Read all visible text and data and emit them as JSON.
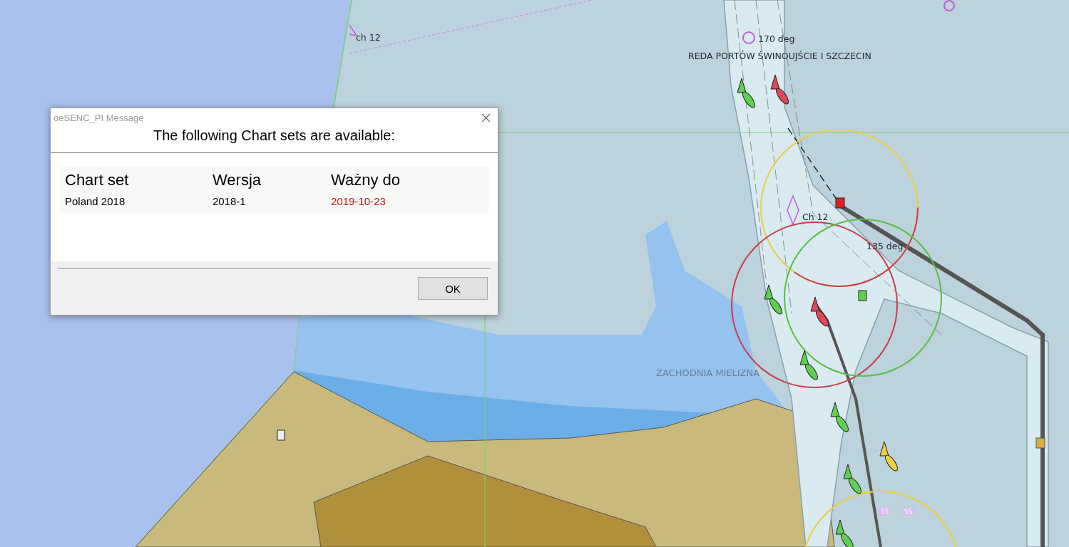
{
  "chart_labels": [
    {
      "text": "ch 12",
      "kind": "name"
    },
    {
      "text": "170 deg",
      "kind": "name"
    },
    {
      "text": "REDA PORTÓW ŚWINOUJŚCIE I SZCZECIN",
      "kind": "name"
    },
    {
      "text": "Ch 12",
      "kind": "name"
    },
    {
      "text": "135 deg",
      "kind": "name"
    },
    {
      "text": "ZACHODNIA MIELIZNA",
      "kind": "area"
    },
    {
      "text": "SS",
      "kind": "tag"
    },
    {
      "text": "SS",
      "kind": "tag"
    }
  ],
  "dialog": {
    "title": "oeSENC_PI Message",
    "heading": "The following Chart sets are available:",
    "columns": [
      "Chart set",
      "Wersja",
      "Ważny do"
    ],
    "rows": [
      {
        "cells": [
          "Poland 2018",
          "2018-1",
          "2019-10-23"
        ],
        "expired": true
      }
    ],
    "buttons": [
      "OK"
    ]
  }
}
